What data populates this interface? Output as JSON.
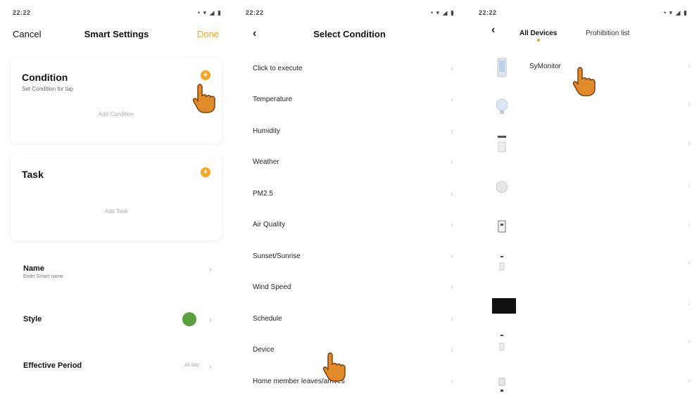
{
  "panel1": {
    "status": {
      "time": "22:22",
      "icons": "• ▾ ◢ ▮"
    },
    "nav": {
      "cancel": "Cancel",
      "title": "Smart Settings",
      "done": "Done"
    },
    "condition_card": {
      "title": "Condition",
      "subtitle": "Set Condition for tap",
      "hint": "Add Condition"
    },
    "task_card": {
      "title": "Task",
      "hint": "Add Task"
    },
    "rows": [
      {
        "label": "Name",
        "sublabel": "Enter Smart name"
      },
      {
        "label": "Style"
      },
      {
        "label": "Effective Period",
        "value": "All day"
      }
    ],
    "accent_color": "#f5a623",
    "style_color": "#5aa040"
  },
  "panel2": {
    "status": {
      "time": "22:22",
      "icons": "• ▾ ◢ ▮"
    },
    "nav": {
      "title": "Select Condition"
    },
    "conditions": [
      "Click to execute",
      "Temperature",
      "Humidity",
      "Weather",
      "PM2.5",
      "Air Quality",
      "Sunset/Sunrise",
      "Wind Speed",
      "Schedule",
      "Device",
      "Home member leaves/arrives"
    ]
  },
  "panel3": {
    "status": {
      "time": "22:22",
      "icons": "• ▾ ◢ ▮"
    },
    "tabs": {
      "active": "All Devices",
      "other": "Prohibition list"
    },
    "devices": [
      {
        "name": "SyMonitor",
        "icon": "phone-device-icon"
      },
      {
        "name": "",
        "icon": "bulb-device-icon"
      },
      {
        "name": "",
        "icon": "switch-device-icon"
      },
      {
        "name": "",
        "icon": "round-device-icon"
      },
      {
        "name": "",
        "icon": "plug-device-icon"
      },
      {
        "name": "",
        "icon": "sensor-device-icon"
      },
      {
        "name": "",
        "icon": "camera-device-icon"
      },
      {
        "name": "",
        "icon": "sensor-device-icon"
      },
      {
        "name": "",
        "icon": "misc-device-icon"
      }
    ]
  }
}
